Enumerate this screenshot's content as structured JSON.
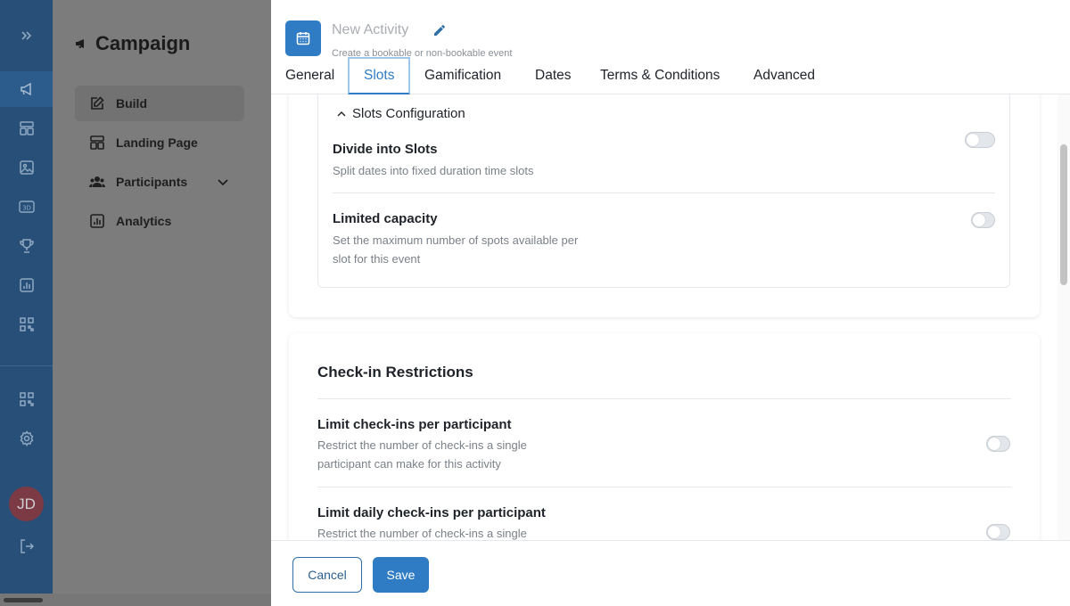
{
  "colors": {
    "accent": "#2f7cc4",
    "rail": "#274f78",
    "avatar": "#7c3a44"
  },
  "rail": {
    "icons": [
      "expand-icon",
      "megaphone-icon",
      "layout-icon",
      "image-icon",
      "3d-icon",
      "trophy-icon",
      "analytics-icon",
      "qr-icon",
      "qr-icon",
      "settings-icon",
      "logout-icon"
    ],
    "avatar_initials": "JD"
  },
  "campaign": {
    "title": "Campaign",
    "nav": [
      {
        "label": "Build",
        "icon": "edit-icon"
      },
      {
        "label": "Landing Page",
        "icon": "layout-icon"
      },
      {
        "label": "Participants",
        "icon": "users-icon"
      },
      {
        "label": "Analytics",
        "icon": "chart-icon"
      }
    ]
  },
  "drawer": {
    "activity_name": "New Activity",
    "subtitle": "Create a bookable or non-bookable event",
    "tabs": [
      "General",
      "Slots",
      "Gamification",
      "Dates",
      "Terms & Conditions",
      "Advanced"
    ],
    "active_tab": "Slots"
  },
  "slots": {
    "section_title": "Slots Configuration",
    "divide": {
      "title": "Divide into Slots",
      "description": "Split dates into fixed duration time slots"
    },
    "capacity": {
      "title": "Limited capacity",
      "description_line1": "Set the maximum number of spots available per",
      "description_line2": "slot for this event"
    }
  },
  "checkin": {
    "title": "Check-in Restrictions",
    "limit": {
      "title": "Limit check-ins per participant",
      "description_line1": "Restrict the number of check-ins a single",
      "description_line2": "participant can make for this activity"
    },
    "daily": {
      "title": "Limit daily check-ins per participant",
      "description_line1": "Restrict the number of check-ins a single"
    }
  },
  "footer": {
    "cancel_label": "Cancel",
    "save_label": "Save"
  }
}
